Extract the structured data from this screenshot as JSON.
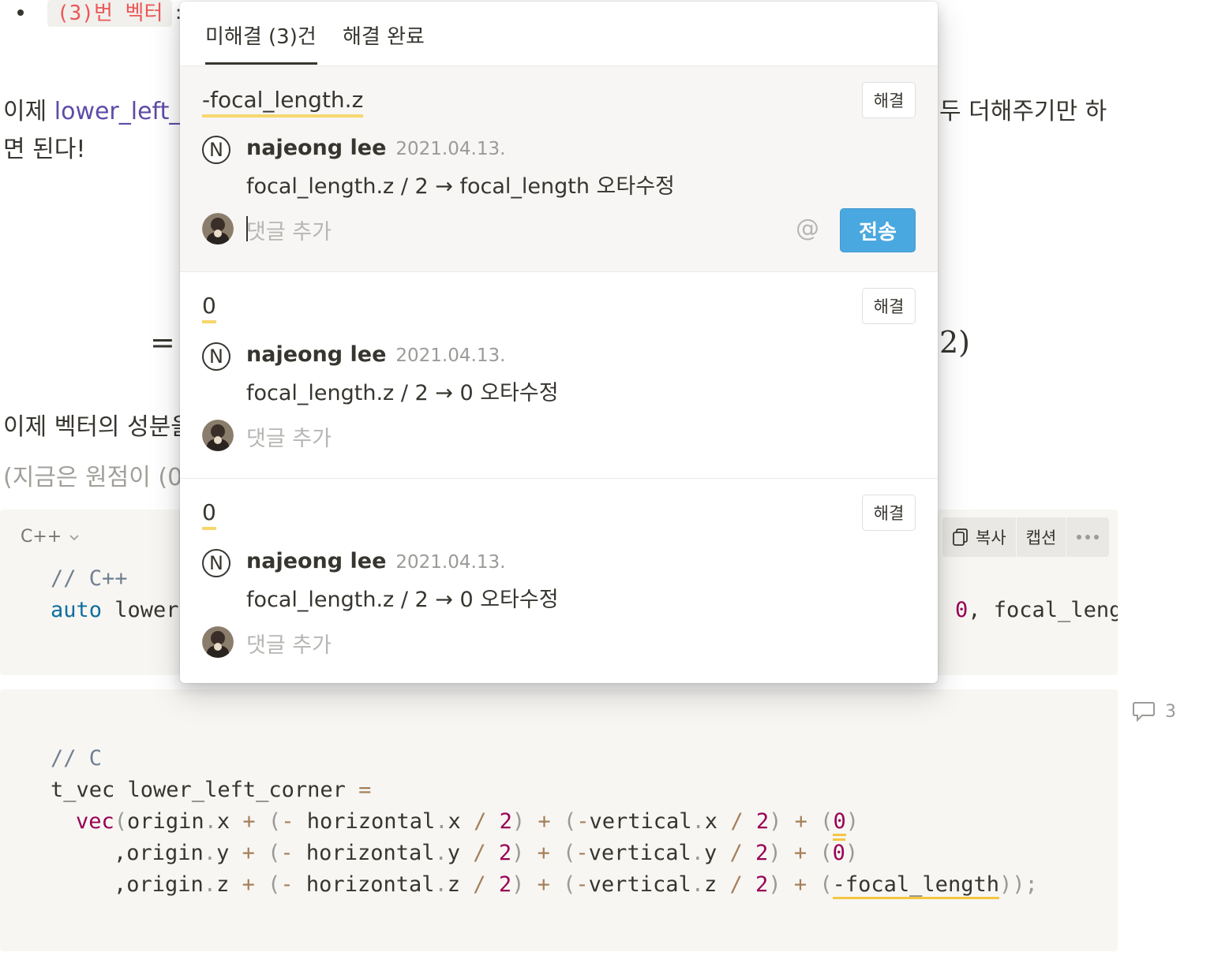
{
  "page": {
    "bullet_code": "(3)번 벡터",
    "bullet_after": ":",
    "para1_line1_prefix": "이제 ",
    "para1_link": "lower_left_",
    "para1_line1_right": "두 더해주기만 하",
    "para1_line2": "면 된다!",
    "eq_left": "=",
    "eq_right": "2)",
    "para2": "이제 벡터의 성분을",
    "para3": "(지금은 원점이 (0"
  },
  "code_block_1": {
    "language": "C++",
    "toolbar": {
      "copy_label": "복사",
      "caption_label": "캡션"
    },
    "line1": "// C++",
    "line2_kw": "auto",
    "line2_rest": " lower",
    "line2_right_num": "0",
    "line2_right_rest": ", focal_leng"
  },
  "code_block_2": {
    "comment": "// C",
    "decl_type": "t_vec",
    "decl_name": " lower_left_corner ",
    "decl_eq": "=",
    "vec_fn": "vec",
    "rows": [
      {
        "lead": "(origin",
        "axis": "x",
        "hz": "horizontal",
        "vt": "vertical",
        "last": "0"
      },
      {
        "lead": ",origin",
        "axis": "y",
        "hz": "horizontal",
        "vt": "vertical",
        "last": "0"
      },
      {
        "lead": ",origin",
        "axis": "z",
        "hz": "horizontal",
        "vt": "vertical",
        "last": "-focal_length"
      }
    ]
  },
  "comment_count": "3",
  "popup": {
    "tabs": [
      {
        "label": "미해결 (3)건",
        "active": true
      },
      {
        "label": "해결 완료",
        "active": false
      }
    ],
    "threads": [
      {
        "quote": "-focal_length.z",
        "resolve_label": "해결",
        "avatar_letter": "N",
        "author": "najeong lee",
        "date": "2021.04.13.",
        "body": "focal_length.z / 2 → focal_length 오타수정",
        "reply_placeholder": "댓글 추가",
        "mention_symbol": "@",
        "send_label": "전송"
      },
      {
        "quote": "0",
        "resolve_label": "해결",
        "avatar_letter": "N",
        "author": "najeong lee",
        "date": "2021.04.13.",
        "body": "focal_length.z / 2 → 0 오타수정",
        "reply_placeholder": "댓글 추가"
      },
      {
        "quote": "0",
        "resolve_label": "해결",
        "avatar_letter": "N",
        "author": "najeong lee",
        "date": "2021.04.13.",
        "body": "focal_length.z / 2 → 0 오타수정",
        "reply_placeholder": "댓글 추가"
      }
    ]
  },
  "icons": {
    "copy": "copy-icon",
    "more": "more-dots-icon",
    "chevron": "chevron-down-icon",
    "comment": "comment-bubble-icon"
  },
  "colors": {
    "accent_send": "#4aa8e0",
    "highlight_underline": "#f5c542",
    "link": "#5f4ba8",
    "inline_code_text": "#eb5757"
  }
}
